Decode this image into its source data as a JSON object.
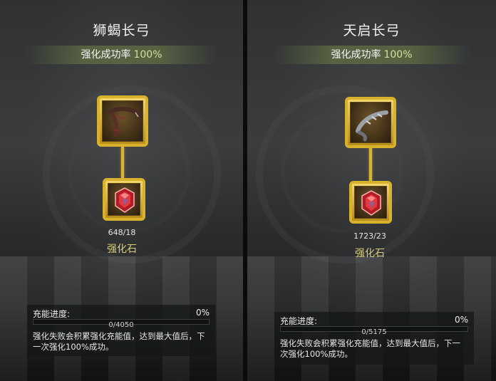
{
  "left": {
    "item_name": "狮蝎长弓",
    "success_label": "强化成功率",
    "success_value": "100%",
    "stone_count": "648/18",
    "stone_name": "强化石",
    "charge_label": "充能进度:",
    "charge_percent": "0%",
    "charge_value": "0/4050",
    "charge_fraction": 0,
    "note": "强化失败会积累强化充能值，达到最大值后，下一次强化100%成功。",
    "weapon_icon": "bow-icon",
    "stone_icon": "red-gem-icon"
  },
  "right": {
    "item_name": "天启长弓",
    "success_label": "强化成功率",
    "success_value": "100%",
    "stone_count": "1723/23",
    "stone_name": "强化石",
    "charge_label": "充能进度:",
    "charge_percent": "0%",
    "charge_value": "0/5175",
    "charge_fraction": 0,
    "note": "强化失败会积累强化充能值，达到最大值后，下一次强化100%成功。",
    "weapon_icon": "bow-icon",
    "stone_icon": "red-gem-icon"
  },
  "colors": {
    "frame_gold": "#d8b22c",
    "rate_green": "#cfe29a",
    "stone_name": "#d7cf7a"
  }
}
